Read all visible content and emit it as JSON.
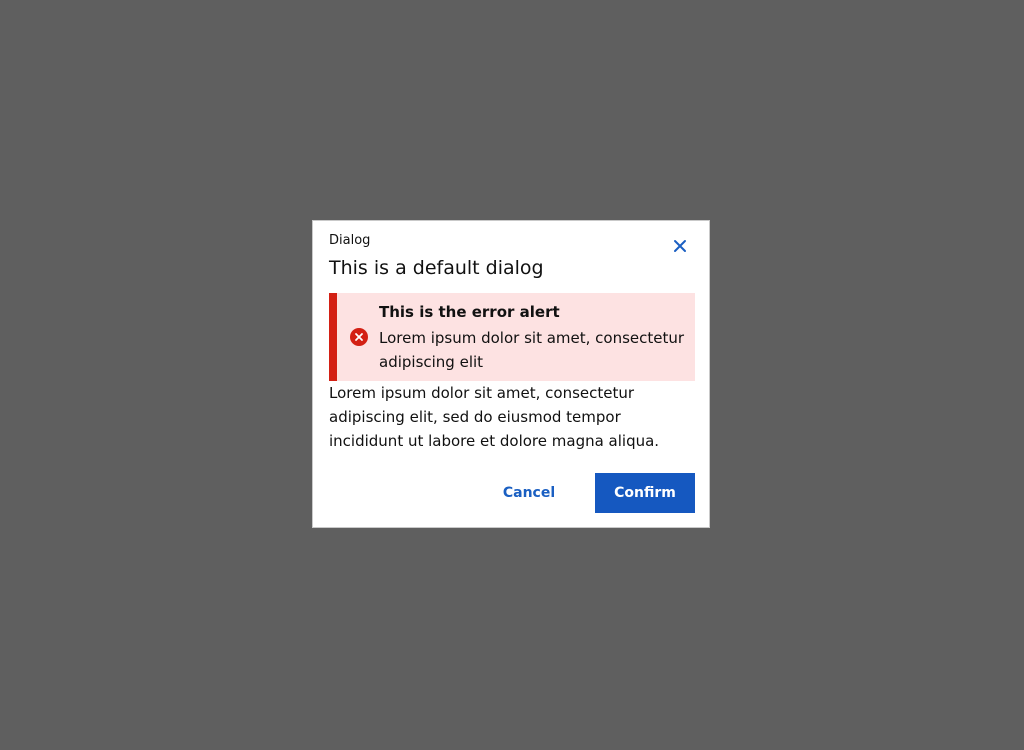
{
  "dialog": {
    "eyebrow": "Dialog",
    "title": "This is a default dialog",
    "close_icon": "close-icon",
    "alert": {
      "icon": "error-circle-icon",
      "title": "This is the error alert",
      "body": "Lorem ipsum dolor sit amet, consectetur adipiscing elit"
    },
    "body": "Lorem ipsum dolor sit amet, consectetur adipiscing elit, sed do eiusmod tempor incididunt ut labore et dolore magna aliqua.",
    "buttons": {
      "cancel_label": "Cancel",
      "confirm_label": "Confirm"
    }
  },
  "colors": {
    "overlay": "#5f5f5f",
    "primary": "#1558c0",
    "error": "#d32014",
    "error_bg": "#fde2e2"
  }
}
